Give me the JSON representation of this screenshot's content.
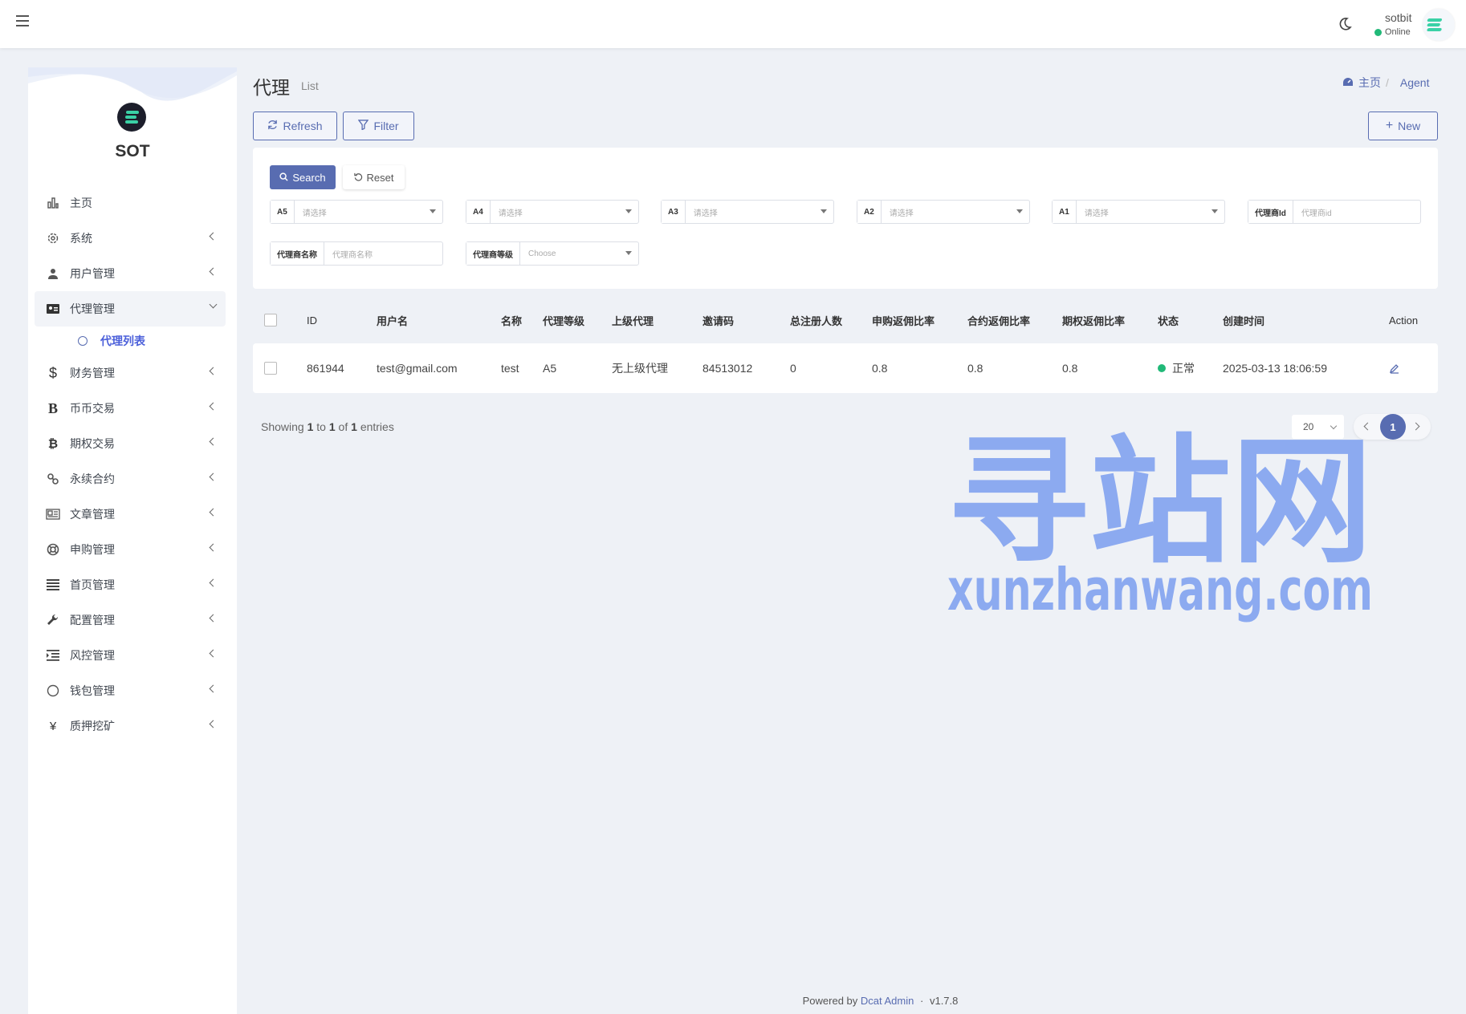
{
  "header": {
    "user_name": "sotbit",
    "user_status": "Online"
  },
  "sidebar": {
    "brand": "SOT",
    "items": [
      {
        "label": "主页",
        "icon": "bar-chart-icon"
      },
      {
        "label": "系统",
        "icon": "gear-icon"
      },
      {
        "label": "用户管理",
        "icon": "user-icon"
      },
      {
        "label": "代理管理",
        "icon": "id-card-icon"
      },
      {
        "label": "财务管理",
        "icon": "dollar-icon"
      },
      {
        "label": "币币交易",
        "icon": "b-icon"
      },
      {
        "label": "期权交易",
        "icon": "bitcoin-icon"
      },
      {
        "label": "永续合约",
        "icon": "link-icon"
      },
      {
        "label": "文章管理",
        "icon": "newspaper-icon"
      },
      {
        "label": "申购管理",
        "icon": "lifebuoy-icon"
      },
      {
        "label": "首页管理",
        "icon": "list-icon"
      },
      {
        "label": "配置管理",
        "icon": "wrench-icon"
      },
      {
        "label": "风控管理",
        "icon": "indent-icon"
      },
      {
        "label": "钱包管理",
        "icon": "circle-icon"
      },
      {
        "label": "质押挖矿",
        "icon": "yen-icon"
      }
    ],
    "subitem": "代理列表"
  },
  "page": {
    "title": "代理",
    "subtitle": "List",
    "breadcrumb_home": "主页",
    "breadcrumb_current": "Agent"
  },
  "toolbar": {
    "refresh": "Refresh",
    "filter": "Filter",
    "new": "New"
  },
  "filters": {
    "search": "Search",
    "reset": "Reset",
    "fields": [
      {
        "label": "A5",
        "value": "请选择"
      },
      {
        "label": "A4",
        "value": "请选择"
      },
      {
        "label": "A3",
        "value": "请选择"
      },
      {
        "label": "A2",
        "value": "请选择"
      },
      {
        "label": "A1",
        "value": "请选择"
      },
      {
        "label": "代理商Id",
        "value": "代理商id"
      },
      {
        "label": "代理商名称",
        "value": "代理商名称"
      },
      {
        "label": "代理商等级",
        "value": "Choose"
      }
    ]
  },
  "table": {
    "headers": [
      "ID",
      "用户名",
      "名称",
      "代理等级",
      "上级代理",
      "邀请码",
      "总注册人数",
      "申购返佣比率",
      "合约返佣比率",
      "期权返佣比率",
      "状态",
      "创建时间",
      "Action"
    ],
    "rows": [
      [
        "861944",
        "test@gmail.com",
        "test",
        "A5",
        "无上级代理",
        "84513012",
        "0",
        "0.8",
        "0.8",
        "0.8",
        "正常",
        "2025-03-13 18:06:59"
      ]
    ]
  },
  "pagination": {
    "showing_prefix": "Showing",
    "from": "1",
    "to_word": "to",
    "to": "1",
    "of_word": "of",
    "total": "1",
    "entries_word": "entries",
    "per_page": "20",
    "current_page": "1"
  },
  "watermark": {
    "title": "寻站网",
    "url": "xunzhanwang.com"
  },
  "footer": {
    "prefix": "Powered by",
    "link": "Dcat Admin",
    "sep": "·",
    "version": "v1.7.8"
  },
  "colors": {
    "accent": "#586cb1",
    "online": "#21b978",
    "watermark": "#7c9ef0"
  }
}
